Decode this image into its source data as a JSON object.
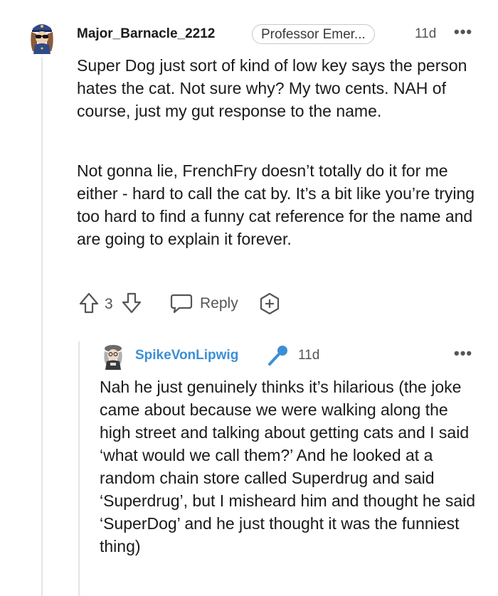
{
  "comment": {
    "username": "Major_Barnacle_2212",
    "flair": "Professor Emer...",
    "age": "11d",
    "more": "•••",
    "paragraphs": [
      "Super Dog just sort of kind of low key says the person hates the cat. Not sure why? My two cents. NAH of course, just my gut response to the name.",
      "Not gonna lie, FrenchFry doesn’t totally do it for me either - hard to call the cat by. It’s a bit like you’re trying too hard to find a funny cat reference for the name and are going to explain it forever."
    ],
    "votes": "3",
    "reply_label": "Reply"
  },
  "reply": {
    "username": "SpikeVonLipwig",
    "age": "11d",
    "more": "•••",
    "text": "Nah he just genuinely thinks it’s hilarious (the joke came about because we were walking along the high street and talking about getting cats and I said ‘what would we call them?’ And he looked at a random chain store called Superdrug and said ‘Superdrug’, but I misheard him and thought he said ‘SuperDog’ and he just thought it was the funniest thing)"
  },
  "icons": {
    "upvote": "upvote-arrow-icon",
    "downvote": "downvote-arrow-icon",
    "reply": "speech-bubble-icon",
    "award": "add-award-icon",
    "mic": "microphone-icon"
  },
  "colors": {
    "reply_username": "#3b8fd4",
    "mic": "#3b8fd4"
  }
}
